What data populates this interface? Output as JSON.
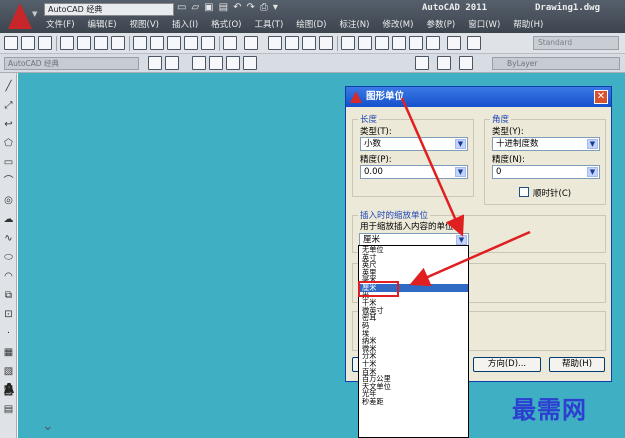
{
  "window": {
    "app_title": "AutoCAD 2011",
    "doc_title": "Drawing1.dwg",
    "workspace": "AutoCAD 经典"
  },
  "menu": [
    "文件(F)",
    "编辑(E)",
    "视图(V)",
    "插入(I)",
    "格式(O)",
    "工具(T)",
    "绘图(D)",
    "标注(N)",
    "修改(M)",
    "参数(P)",
    "窗口(W)",
    "帮助(H)"
  ],
  "toolbar": {
    "text_style": "Standard",
    "workspace2": "AutoCAD 经典",
    "layer_value": "ByLayer"
  },
  "dialog": {
    "title": "图形单位",
    "length": {
      "group_label": "长度",
      "type_label": "类型(T):",
      "type_value": "小数",
      "precision_label": "精度(P):",
      "precision_value": "0.00"
    },
    "angle": {
      "group_label": "角度",
      "type_label": "类型(Y):",
      "type_value": "十进制度数",
      "precision_label": "精度(N):",
      "precision_value": "0",
      "clockwise_label": "顺时针(C)"
    },
    "insert": {
      "group_label": "插入时的缩放单位",
      "desc": "用于缩放插入内容的单位:",
      "value": "厘米"
    },
    "buttons": {
      "direction": "方向(D)...",
      "help": "帮助(H)"
    }
  },
  "unit_list": {
    "items": [
      "无单位",
      "英寸",
      "英尺",
      "英里",
      "毫米",
      "厘米",
      "米",
      "千米",
      "微英寸",
      "密耳",
      "码",
      "埃",
      "纳米",
      "微米",
      "分米",
      "十米",
      "百米",
      "百万公里",
      "天文单位",
      "光年",
      "秒差距"
    ],
    "selected": "厘米"
  },
  "watermark": "最需网",
  "colors": {
    "canvas": "#3fb0c4",
    "dialog_title": "#1550cc",
    "selection": "#316ac5",
    "annotation": "#e02020"
  }
}
